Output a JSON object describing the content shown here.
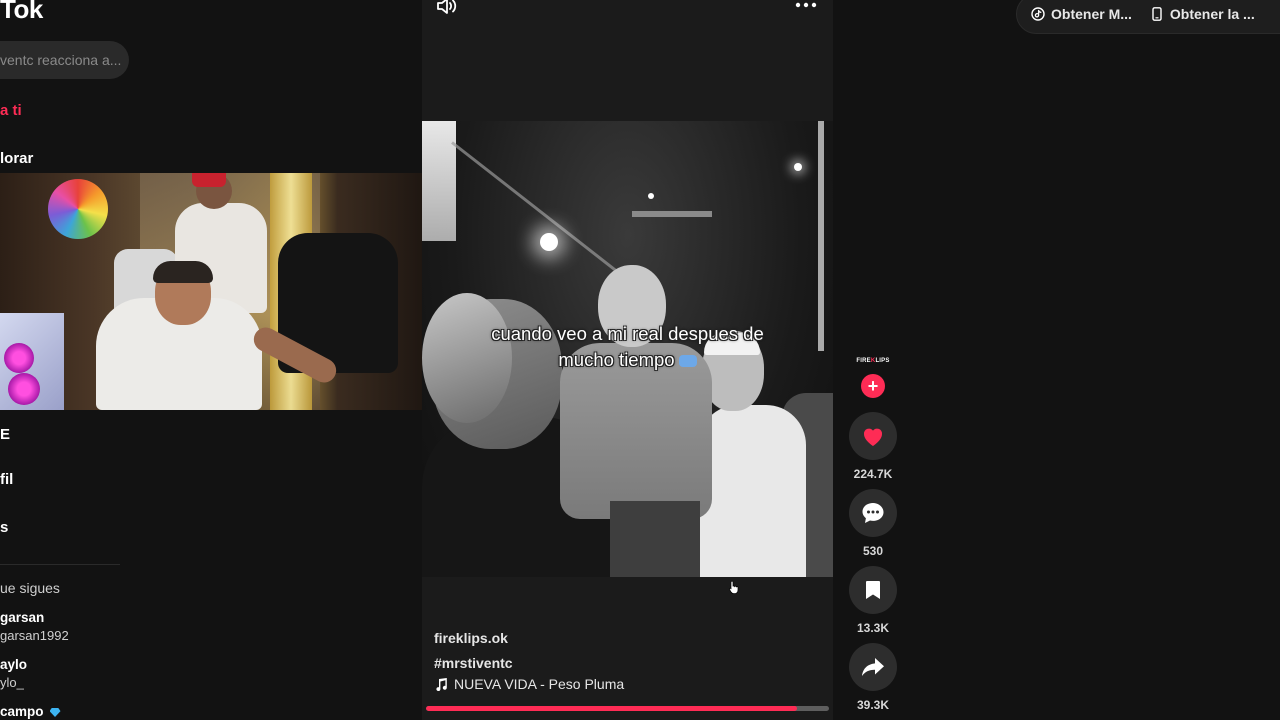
{
  "app": {
    "logo": "Tok"
  },
  "search": {
    "placeholder": "ventc reacciona a..."
  },
  "nav": {
    "for_you": "a ti",
    "explore": "lorar",
    "live": "E",
    "profile": "fil",
    "more": "s"
  },
  "following": {
    "title": "ue sigues",
    "accounts": [
      {
        "name": "garsan",
        "handle": "garsan1992"
      },
      {
        "name": "aylo",
        "handle": "ylo_"
      },
      {
        "name": "campo",
        "handle": ""
      }
    ]
  },
  "video": {
    "caption_line1": "cuando veo a mi real despues de",
    "caption_line2": "mucho tiempo",
    "author": "fireklips.ok",
    "hashtag": "#mrstiventc",
    "music": "NUEVA VIDA - Peso Pluma",
    "progress_fraction": 0.92
  },
  "actions": {
    "creator_logo_a": "FIRE",
    "creator_logo_k": "K",
    "creator_logo_b": "LIPS",
    "follow": "+",
    "likes": "224.7K",
    "comments": "530",
    "saves": "13.3K",
    "shares": "39.3K"
  },
  "top_links": {
    "get_music": "Obtener M...",
    "get_app": "Obtener la ..."
  },
  "colors": {
    "accent": "#fe2c55",
    "background": "#121212",
    "feed": "#1b1b1b"
  },
  "icons": [
    "volume-icon",
    "more-icon",
    "music-note-icon",
    "heart-icon",
    "comment-icon",
    "bookmark-icon",
    "share-icon",
    "tiktok-icon",
    "phone-icon"
  ]
}
